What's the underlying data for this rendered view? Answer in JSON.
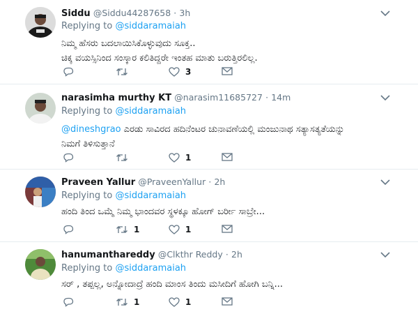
{
  "tweets": [
    {
      "name": "Siddu",
      "handle": "@Siddu44287658",
      "separator": "·",
      "time": "3h",
      "replying_prefix": "Replying to",
      "replying_to": "@siddaramaiah",
      "lines": [
        "ನಿಮ್ಮ ಹೆಸರು ಬದಲಾಯಿಸಿಕೊಳ್ಳುವುದು ಸೂಕ್ತ..",
        "ಚಿಕ್ಕ ವಯಸ್ಸಿನಿಂದ ಸಂಸ್ಕಾರ ಕಲಿತಿದ್ದರೇ ಇಂತಹ ಮಾತು ಬರುತ್ತಿರಲಿಲ್ಲ."
      ],
      "reply_count": "",
      "retweet_count": "",
      "like_count": "3",
      "avatar_colors": [
        "#1a1a1a",
        "#e8e8e8"
      ]
    },
    {
      "name": "narasimha murthy KT",
      "handle": "@narasim11685727",
      "separator": "·",
      "time": "14m",
      "replying_prefix": "Replying to",
      "replying_to": "@siddaramaiah",
      "mention": "@dineshgrao",
      "lines": [
        "ಎರಡು ಸಾವಿರದ ಹದಿನೆಂಟರ ಚುನಾವಣೆಯಲ್ಲಿ ಮಂಜುನಾಥ ಸತ್ಯಾಸತ್ಯತೆಯನ್ನು",
        "ನಿಮಗೆ ತಿಳಿಸುತ್ತಾನೆ"
      ],
      "reply_count": "",
      "retweet_count": "",
      "like_count": "1",
      "avatar_colors": [
        "#cfd8cf",
        "#6b4a3a"
      ]
    },
    {
      "name": "Praveen Yallur",
      "handle": "@PraveenYallur",
      "separator": "·",
      "time": "2h",
      "replying_prefix": "Replying to",
      "replying_to": "@siddaramaiah",
      "lines": [
        "ಹಂದಿ ತಿಂದ ಒಮ್ಮೆ ನಿಮ್ಮ ಭಾಂದವರ ಸ್ಥಳಕ್ಕೂ ಹೋಗ್ ಬರ್ರೀ ಸಾಬ್ರೇ..."
      ],
      "reply_count": "",
      "retweet_count": "1",
      "like_count": "1",
      "avatar_colors": [
        "#7a3a3a",
        "#2f5fa8"
      ]
    },
    {
      "name": "hanumanthareddy",
      "handle": "@Clkthr Reddy",
      "separator": "·",
      "time": "2h",
      "replying_prefix": "Replying to",
      "replying_to": "@siddaramaiah",
      "lines": [
        "ಸರ್ , ತಪ್ಪಲ್ಲ, ಅನ್ನೋದಾದ್ರೆ ಹಂದಿ ಮಾಂಸ ತಿಂದು ಮಸೀದಿಗೆ ಹೋಗಿ ಬನ್ನಿ..."
      ],
      "reply_count": "",
      "retweet_count": "1",
      "like_count": "1",
      "avatar_colors": [
        "#4e8a3a",
        "#e9e2c0"
      ]
    }
  ],
  "icons": {
    "reply": "reply-icon",
    "retweet": "retweet-icon",
    "like": "heart-icon",
    "dm": "envelope-icon",
    "menu": "chevron-down-icon"
  },
  "colors": {
    "link": "#1da1f2",
    "muted": "#657786",
    "text": "#14171a",
    "divider": "#e6ecf0"
  }
}
